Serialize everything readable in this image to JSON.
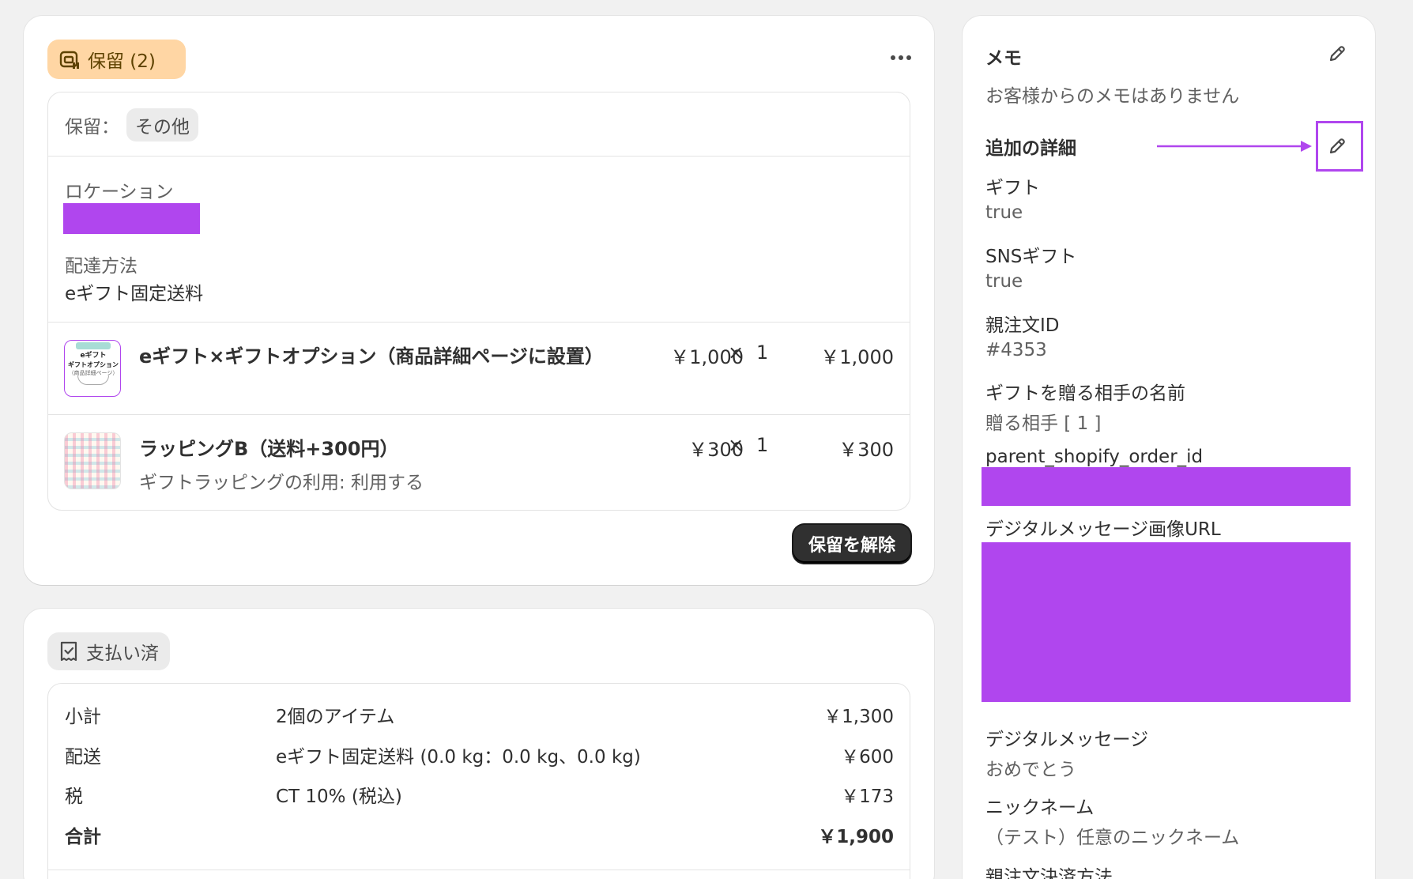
{
  "hold_card": {
    "badge_label": "保留 (2)",
    "more_icon": "ellipsis-horizontal-icon",
    "reason_label": "保留：",
    "reason_tag": "その他",
    "location_label": "ロケーション",
    "delivery_label": "配達方法",
    "delivery_value": "eギフト固定送料",
    "items": [
      {
        "title": "eギフト×ギフトオプション（商品詳細ページに設置）",
        "unit_price": "￥1,000",
        "times": "×",
        "qty": "1",
        "total": "￥1,000",
        "thumb_lines": [
          "eギフト",
          "ギフトオプション",
          "（商品詳細ページ）"
        ]
      },
      {
        "title": "ラッピングB（送料+300円）",
        "subtitle": "ギフトラッピングの利用: 利用する",
        "unit_price": "￥300",
        "times": "×",
        "qty": "1",
        "total": "￥300"
      }
    ],
    "release_button": "保留を解除"
  },
  "payment_card": {
    "badge_label": "支払い済",
    "rows": [
      {
        "label": "小計",
        "desc": "2個のアイテム",
        "amount": "￥1,300"
      },
      {
        "label": "配送",
        "desc": "eギフト固定送料 (0.0 kg：0.0 kg、0.0 kg)",
        "amount": "￥600"
      },
      {
        "label": "税",
        "desc": "CT 10% (税込)",
        "amount": "￥173"
      },
      {
        "label": "合計",
        "desc": "",
        "amount": "￥1,900"
      }
    ]
  },
  "side_card": {
    "memo_title": "メモ",
    "memo_text": "お客様からのメモはありません",
    "details_title": "追加の詳細",
    "fields": [
      {
        "label": "ギフト",
        "value": "true"
      },
      {
        "label": "SNSギフト",
        "value": "true"
      },
      {
        "label": "親注文ID",
        "value": "#4353"
      },
      {
        "label": "ギフトを贈る相手の名前",
        "value": "贈る相手 [ 1 ]"
      },
      {
        "label": "parent_shopify_order_id",
        "value": ""
      },
      {
        "label": "デジタルメッセージ画像URL",
        "value": ""
      },
      {
        "label": "デジタルメッセージ",
        "value": "おめでとう"
      },
      {
        "label": "ニックネーム",
        "value": "（テスト）任意のニックネーム"
      },
      {
        "label": "親注文決済方法",
        "value": ""
      }
    ]
  },
  "colors": {
    "background": "#f1f1f1",
    "card": "#ffffff",
    "hold_badge_bg": "#ffd6a4",
    "paid_badge_bg": "#ebebeb",
    "redaction": "#b046ee",
    "annotation": "#b046ee",
    "dark_button": "#303030"
  }
}
